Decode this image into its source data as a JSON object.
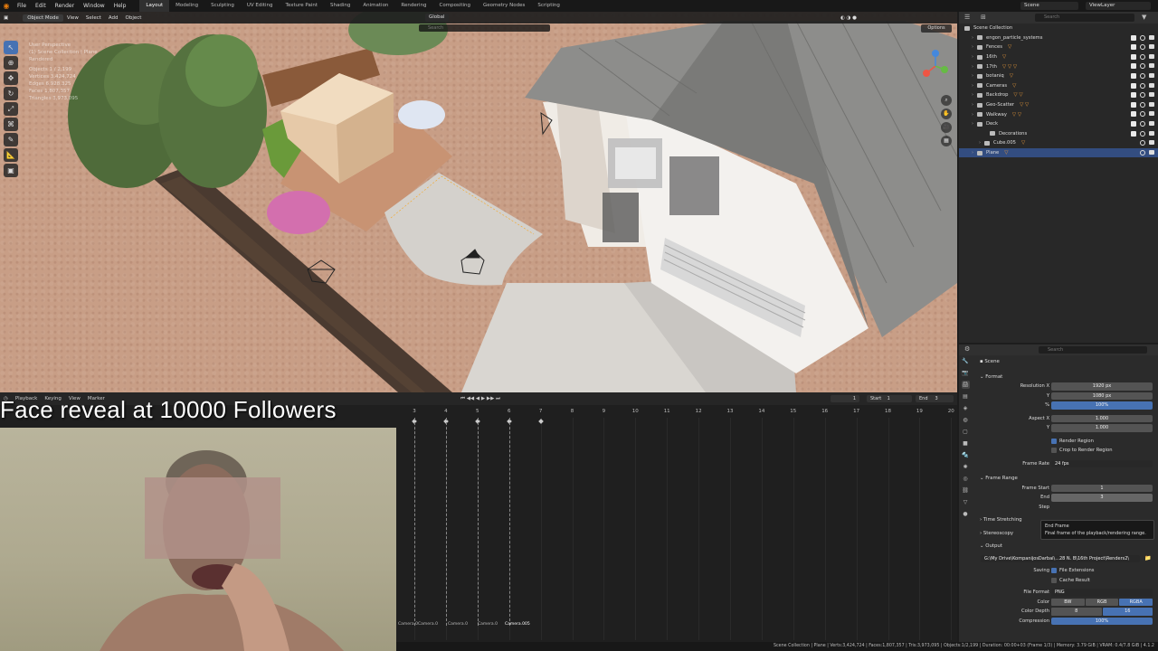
{
  "topbar": {
    "menus": [
      "File",
      "Edit",
      "Render",
      "Window",
      "Help"
    ],
    "workspaces": [
      "Layout",
      "Modeling",
      "Sculpting",
      "UV Editing",
      "Texture Paint",
      "Shading",
      "Animation",
      "Rendering",
      "Compositing",
      "Geometry Nodes",
      "Scripting"
    ],
    "active_workspace": "Layout",
    "scene": "Scene",
    "view_layer": "ViewLayer"
  },
  "viewport": {
    "mode": "Object Mode",
    "header_menus": [
      "View",
      "Select",
      "Add",
      "Object"
    ],
    "transform_orientation": "Global",
    "search_placeholder": "Search",
    "options_label": "Options",
    "info_lines": [
      "User Perspective",
      "(1) Scene Collection | Plane",
      "Rendered"
    ],
    "stats": [
      {
        "label": "Objects",
        "value": "1 / 2,199"
      },
      {
        "label": "Vertices",
        "value": "3,424,724"
      },
      {
        "label": "Edges",
        "value": "6,928,325"
      },
      {
        "label": "Faces",
        "value": "1,807,357"
      },
      {
        "label": "Triangles",
        "value": "3,973,095"
      }
    ]
  },
  "timeline": {
    "menus": [
      "Playback",
      "Keying",
      "View",
      "Marker"
    ],
    "current_frame": "1",
    "start_label": "Start",
    "start": "1",
    "end_label": "End",
    "end": "3",
    "ruler": [
      "3",
      "4",
      "5",
      "6",
      "7",
      "8",
      "9",
      "10",
      "11",
      "12",
      "13",
      "14",
      "15",
      "16",
      "17",
      "18",
      "19",
      "20"
    ],
    "markers": [
      "Camera.0",
      "Camera.0",
      "Camera.0",
      "Camera.0",
      "Camera.005"
    ]
  },
  "overlay": {
    "title": "Face reveal at 10000 Followers"
  },
  "outliner": {
    "search_placeholder": "Search",
    "root": "Scene Collection",
    "items": [
      {
        "label": "engon_particle_systems",
        "selected": false
      },
      {
        "label": "Fences",
        "selected": false
      },
      {
        "label": "16th",
        "selected": false
      },
      {
        "label": "17th",
        "selected": false
      },
      {
        "label": "botaniq",
        "selected": false
      },
      {
        "label": "Cameras",
        "selected": false
      },
      {
        "label": "Backdrop",
        "selected": false
      },
      {
        "label": "Geo-Scatter",
        "selected": false
      },
      {
        "label": "Walkway",
        "selected": false
      },
      {
        "label": "Deck",
        "selected": false
      },
      {
        "label": "Decorations",
        "selected": false
      },
      {
        "label": "Cube.005",
        "selected": false
      },
      {
        "label": "Plane",
        "selected": true
      }
    ]
  },
  "properties": {
    "search_placeholder": "Search",
    "context": "Scene",
    "format_section": "Format",
    "resolution_x_label": "Resolution X",
    "resolution_x": "1920 px",
    "resolution_y_label": "Y",
    "resolution_y": "1080 px",
    "resolution_pct_label": "%",
    "resolution_pct": "100%",
    "aspect_x_label": "Aspect X",
    "aspect_x": "1.000",
    "aspect_y_label": "Y",
    "aspect_y": "1.000",
    "render_region": "Render Region",
    "crop_region": "Crop to Render Region",
    "frame_rate_label": "Frame Rate",
    "frame_rate": "24 fps",
    "frame_range_section": "Frame Range",
    "frame_start_label": "Frame Start",
    "frame_start": "1",
    "end_label": "End",
    "end_value": "3",
    "step_label": "Step",
    "time_stretching": "Time Stretching",
    "stereoscopy": "Stereoscopy",
    "output_section": "Output",
    "output_path": "G:\\My Drive\\KompanijosDarbai\\...28 N. B\\16th Project\\Renders2\\",
    "saving_label": "Saving",
    "file_extensions": "File Extensions",
    "cache_result": "Cache Result",
    "file_format_label": "File Format",
    "file_format": "PNG",
    "color_label": "Color",
    "color_options": [
      "BW",
      "RGB",
      "RGBA"
    ],
    "color_selected": "RGBA",
    "color_depth_label": "Color Depth",
    "color_depth_options": [
      "8",
      "16"
    ],
    "color_depth_selected": "16",
    "compression_label": "Compression",
    "compression": "100%"
  },
  "tooltip": {
    "title": "End Frame",
    "text": "Final frame of the playback/rendering range."
  },
  "statusbar": {
    "text": "Scene Collection | Plane | Verts:3,424,724 | Faces:1,807,357 | Tris:3,973,095 | Objects:1/2,199 | Duration: 00:00+03 (Frame 1/3) | Memory: 3.79 GiB | VRAM: 0.4/7.8 GiB | 4.1.2"
  },
  "colors": {
    "accent": "#4772b3",
    "selection": "#334d80",
    "header_bg": "#303030",
    "orange_icon": "#e99a3a"
  }
}
